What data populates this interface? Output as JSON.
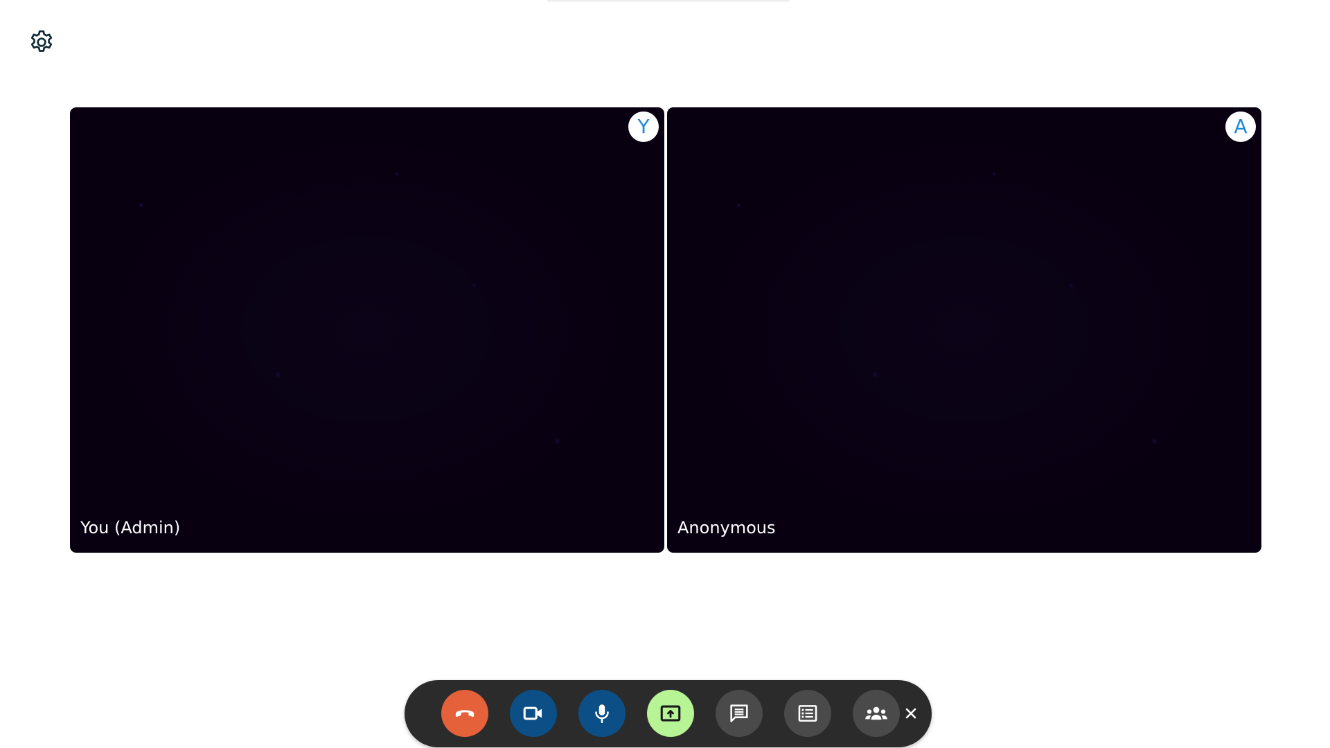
{
  "header": {
    "settings_icon": "gear-icon"
  },
  "participants": [
    {
      "name": "You (Admin)",
      "initial": "Y"
    },
    {
      "name": "Anonymous",
      "initial": "A"
    }
  ],
  "toolbar": {
    "buttons": [
      {
        "id": "end-call",
        "icon": "phone-hangup-icon",
        "color": "#e4613a"
      },
      {
        "id": "camera",
        "icon": "video-camera-icon",
        "color": "#0c4f86"
      },
      {
        "id": "microphone",
        "icon": "microphone-icon",
        "color": "#0c4f86"
      },
      {
        "id": "share-screen",
        "icon": "screen-share-icon",
        "color": "#b7f495"
      },
      {
        "id": "chat",
        "icon": "chat-icon",
        "color": "#4a4a4a"
      },
      {
        "id": "list",
        "icon": "list-icon",
        "color": "#4a4a4a"
      },
      {
        "id": "participants",
        "icon": "people-group-icon",
        "color": "#4a4a4a"
      }
    ],
    "close_icon": "close-icon"
  },
  "colors": {
    "avatar_text": "#1c8ad8",
    "tile_background": "#08000f",
    "toolbar_background": "#2b2b2b"
  }
}
